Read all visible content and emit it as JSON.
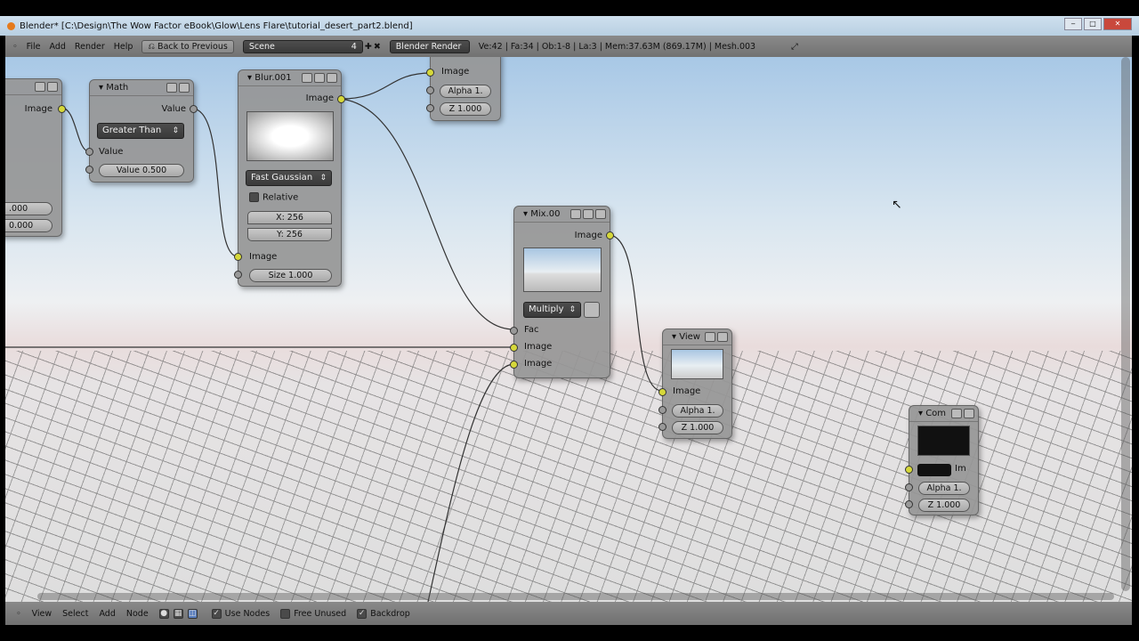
{
  "window": {
    "title": "Blender* [C:\\Design\\The Wow Factor eBook\\Glow\\Lens Flare\\tutorial_desert_part2.blend]",
    "min": "‒",
    "max": "□",
    "close": "✕"
  },
  "header": {
    "menus": [
      "File",
      "Add",
      "Render",
      "Help"
    ],
    "back_label": "Back to Previous",
    "scene": "Scene",
    "scene_users": "4",
    "engine": "Blender Render",
    "stats": "Ve:42 | Fa:34 | Ob:1-8 | La:3 | Mem:37.63M (869.17M) | Mesh.003"
  },
  "footer": {
    "menus": [
      "View",
      "Select",
      "Add",
      "Node"
    ],
    "use_nodes": "Use Nodes",
    "free_unused": "Free Unused",
    "backdrop": "Backdrop",
    "use_nodes_checked": true,
    "free_unused_checked": false,
    "backdrop_checked": true
  },
  "nodes": {
    "left": {
      "output": "Image",
      "f1": ".000",
      "f2": "0.000"
    },
    "math": {
      "title": "Math",
      "output": "Value",
      "operation": "Greater Than",
      "input": "Value",
      "value": "Value 0.500"
    },
    "blur": {
      "title": "Blur.001",
      "output": "Image",
      "filter": "Fast Gaussian",
      "relative": "Relative",
      "x": "X: 256",
      "y": "Y: 256",
      "input": "Image",
      "size": "Size 1.000"
    },
    "top": {
      "input": "Image",
      "alpha": "Alpha 1.",
      "z": "Z 1.000"
    },
    "mix": {
      "title": "Mix.00",
      "output": "Image",
      "blend": "Multiply",
      "fac": "Fac",
      "in1": "Image",
      "in2": "Image"
    },
    "view": {
      "title": "View",
      "input": "Image",
      "alpha": "Alpha 1.",
      "z": "Z 1.000"
    },
    "comp": {
      "title": "Com",
      "input": "Im",
      "alpha": "Alpha 1.",
      "z": "Z 1.000"
    }
  },
  "colors": {
    "socket_image": "#d6d83a",
    "socket_value": "#999999",
    "header": "#7d7d7d"
  }
}
